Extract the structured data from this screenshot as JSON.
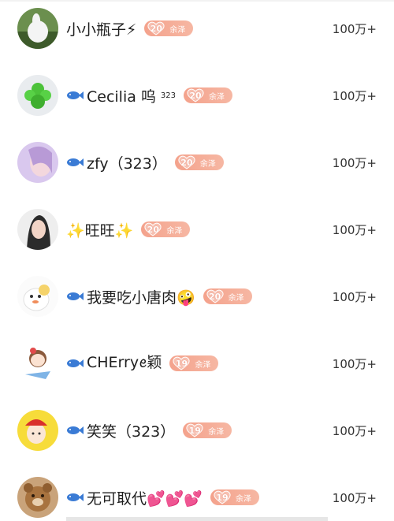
{
  "rows": [
    {
      "name": "小小瓶子⚡",
      "fish": false,
      "sup": "",
      "level": "20",
      "badge_name": "余泽",
      "count": "100万+"
    },
    {
      "name": "Cecilia 呜",
      "fish": true,
      "sup": "323",
      "level": "20",
      "badge_name": "余泽",
      "count": "100万+"
    },
    {
      "name": "zfy（323）",
      "fish": true,
      "sup": "",
      "level": "20",
      "badge_name": "余泽",
      "count": "100万+"
    },
    {
      "name": "✨旺旺✨",
      "fish": false,
      "sup": "",
      "level": "20",
      "badge_name": "余泽",
      "count": "100万+"
    },
    {
      "name": "我要吃小唐肉🤪",
      "fish": true,
      "sup": "",
      "level": "20",
      "badge_name": "余泽",
      "count": "100万+"
    },
    {
      "name": "CHErryꫀ颖",
      "fish": true,
      "sup": "",
      "level": "19",
      "badge_name": "余泽",
      "count": "100万+"
    },
    {
      "name": "笑笑（323）",
      "fish": true,
      "sup": "",
      "level": "19",
      "badge_name": "余泽",
      "count": "100万+"
    },
    {
      "name": "无可取代💕💕💕",
      "fish": true,
      "sup": "",
      "level": "19",
      "badge_name": "余泽",
      "count": "100万+"
    }
  ],
  "icons": {
    "fish": "fish-icon",
    "badge": "heart-level-icon"
  },
  "colors": {
    "badge_start": "#f4a28c",
    "badge_end": "#f6b7a3",
    "fish": "#3a7bd5"
  }
}
